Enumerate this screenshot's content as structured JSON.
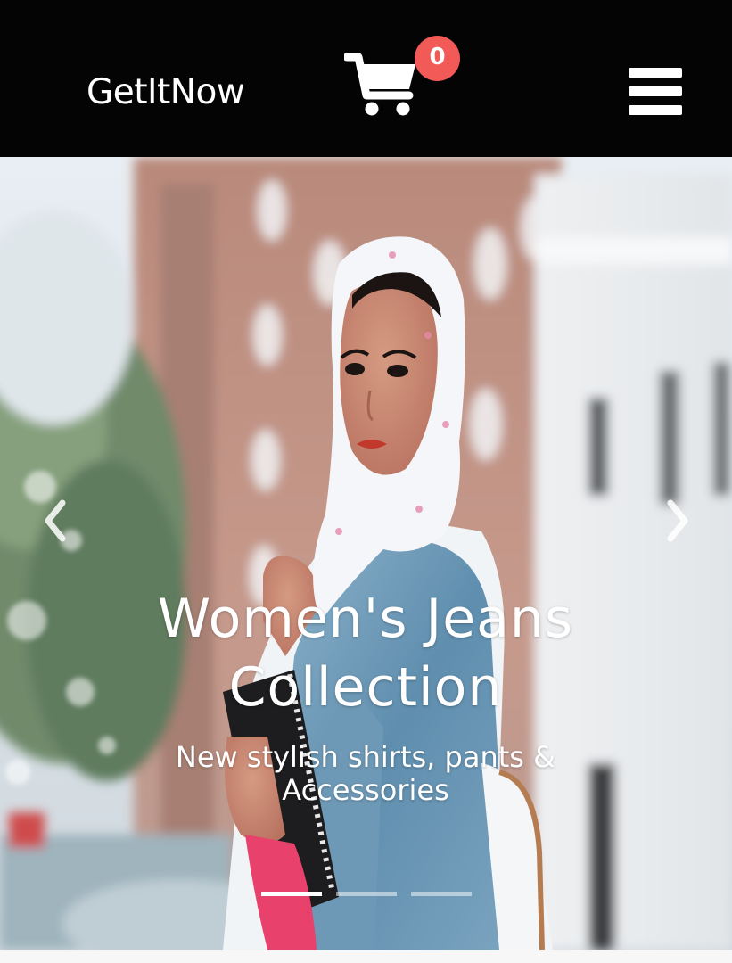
{
  "colors": {
    "navbar_bg": "#040404",
    "brand_text": "#ffffff",
    "badge_bg": "#f15a57",
    "icon": "#ffffff"
  },
  "navbar": {
    "brand": "GetItNow",
    "cart_icon": "shopping-cart-icon",
    "cart_count": "0",
    "menu_icon": "hamburger-menu-icon"
  },
  "carousel": {
    "prev_icon": "chevron-left-icon",
    "next_icon": "chevron-right-icon",
    "active_slide": 1,
    "slide_count": 3,
    "slide": {
      "title": "Women's Jeans Collection",
      "subtitle": "New stylish shirts, pants & Accessories"
    }
  }
}
